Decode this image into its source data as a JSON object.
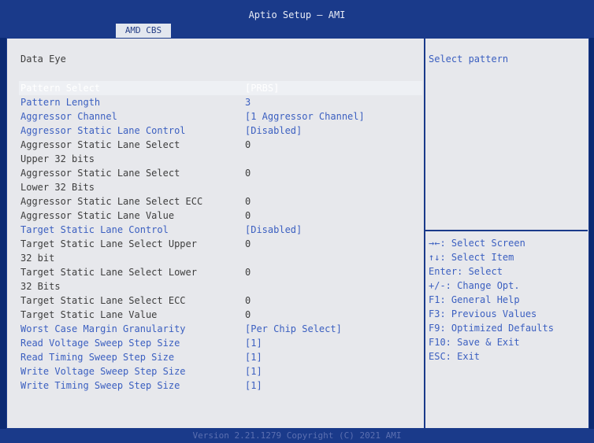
{
  "header": {
    "title": "Aptio Setup – AMI",
    "tab_label": "AMD CBS"
  },
  "main": {
    "section_title": "Data Eye",
    "rows": [
      {
        "label": "Pattern Select",
        "value": "[PRBS]",
        "style": "white",
        "interactable": true
      },
      {
        "label": "Pattern Length",
        "value": "3",
        "style": "blue",
        "interactable": true
      },
      {
        "label": "Aggressor Channel",
        "value": "[1 Aggressor Channel]",
        "style": "blue",
        "interactable": true
      },
      {
        "label": "Aggressor Static Lane Control",
        "value": "[Disabled]",
        "style": "blue",
        "interactable": true
      },
      {
        "label": "Aggressor Static Lane Select",
        "label2": "Upper 32 bits",
        "value": "0",
        "style": "gray",
        "interactable": false
      },
      {
        "label": "Aggressor Static Lane Select",
        "label2": "Lower 32 Bits",
        "value": "0",
        "style": "gray",
        "interactable": false
      },
      {
        "label": "Aggressor Static Lane Select ECC",
        "value": "0",
        "style": "gray",
        "interactable": false
      },
      {
        "label": "Aggressor Static Lane Value",
        "value": "0",
        "style": "gray",
        "interactable": false
      },
      {
        "label": "Target Static Lane Control",
        "value": "[Disabled]",
        "style": "blue",
        "interactable": true
      },
      {
        "label": "Target Static Lane Select Upper",
        "label2": "32 bit",
        "value": "0",
        "style": "gray",
        "interactable": false
      },
      {
        "label": "Target Static Lane Select Lower",
        "label2": "32 Bits",
        "value": "0",
        "style": "gray",
        "interactable": false
      },
      {
        "label": "Target Static Lane Select ECC",
        "value": "0",
        "style": "gray",
        "interactable": false
      },
      {
        "label": "Target Static Lane Value",
        "value": "0",
        "style": "gray",
        "interactable": false
      },
      {
        "label": "Worst Case Margin Granularity",
        "value": "[Per Chip Select]",
        "style": "blue",
        "interactable": true
      },
      {
        "label": "Read Voltage Sweep Step Size",
        "value": "[1]",
        "style": "blue",
        "interactable": true
      },
      {
        "label": "Read Timing Sweep Step Size",
        "value": "[1]",
        "style": "blue",
        "interactable": true
      },
      {
        "label": "Write Voltage Sweep Step Size",
        "value": "[1]",
        "style": "blue",
        "interactable": true
      },
      {
        "label": "Write Timing Sweep Step Size",
        "value": "[1]",
        "style": "blue",
        "interactable": true
      }
    ]
  },
  "help": {
    "description": "Select pattern",
    "keys": [
      "→←: Select Screen",
      "↑↓: Select Item",
      "Enter: Select",
      "+/-: Change Opt.",
      "F1: General Help",
      "F3: Previous Values",
      "F9: Optimized Defaults",
      "F10: Save & Exit",
      "ESC: Exit"
    ]
  },
  "footer": {
    "version_text": "Version 2.21.1279 Copyright (C) 2021 AMI"
  },
  "colors": {
    "frame_bg": "#e7e8ec",
    "bar_blue": "#1a3a8a",
    "item_blue": "#3b5fc0",
    "selected_text": "#ffffff",
    "static_text": "#3e3e3e"
  }
}
